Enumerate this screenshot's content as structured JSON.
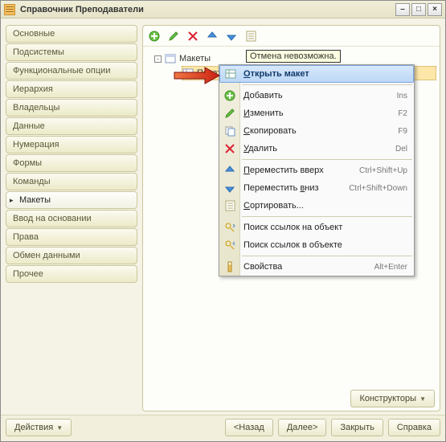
{
  "window": {
    "title": "Справочник Преподаватели"
  },
  "sidebar": {
    "items": [
      {
        "label": "Основные"
      },
      {
        "label": "Подсистемы"
      },
      {
        "label": "Функциональные опции"
      },
      {
        "label": "Иерархия"
      },
      {
        "label": "Владельцы"
      },
      {
        "label": "Данные"
      },
      {
        "label": "Нумерация"
      },
      {
        "label": "Формы"
      },
      {
        "label": "Команды"
      },
      {
        "label": "Макеты",
        "active": true
      },
      {
        "label": "Ввод на основании"
      },
      {
        "label": "Права"
      },
      {
        "label": "Обмен данными"
      },
      {
        "label": "Прочее"
      }
    ]
  },
  "tree": {
    "root_label": "Макеты",
    "child_label": "Печат"
  },
  "tooltip": {
    "text": "Отмена невозможна."
  },
  "context_menu": {
    "items": [
      {
        "label": "Открыть макет",
        "u": 0,
        "shortcut": "",
        "icon": "open-layout",
        "hover": true
      },
      {
        "sep": true
      },
      {
        "label": "Добавить",
        "u": 0,
        "shortcut": "Ins",
        "icon": "add"
      },
      {
        "label": "Изменить",
        "u": 0,
        "shortcut": "F2",
        "icon": "edit"
      },
      {
        "label": "Скопировать",
        "u": 0,
        "shortcut": "F9",
        "icon": "copy"
      },
      {
        "label": "Удалить",
        "u": 0,
        "shortcut": "Del",
        "icon": "delete"
      },
      {
        "sep": true
      },
      {
        "label": "Переместить вверх",
        "u": 0,
        "shortcut": "Ctrl+Shift+Up",
        "icon": "move-up"
      },
      {
        "label": "Переместить вниз",
        "u": 12,
        "shortcut": "Ctrl+Shift+Down",
        "icon": "move-down"
      },
      {
        "label": "Сортировать...",
        "u": 0,
        "shortcut": "",
        "icon": "sort"
      },
      {
        "sep": true
      },
      {
        "label": "Поиск ссылок на объект",
        "u": -1,
        "shortcut": "",
        "icon": "find-refs-to"
      },
      {
        "label": "Поиск ссылок в объекте",
        "u": -1,
        "shortcut": "",
        "icon": "find-refs-in"
      },
      {
        "sep": true
      },
      {
        "label": "Свойства",
        "u": -1,
        "shortcut": "Alt+Enter",
        "icon": "properties"
      }
    ]
  },
  "footer": {
    "constructors": "Конструкторы",
    "actions": "Действия",
    "back": "<Назад",
    "next": "Далее>",
    "close": "Закрыть",
    "help": "Справка"
  }
}
